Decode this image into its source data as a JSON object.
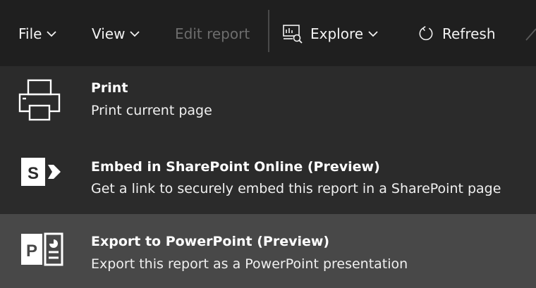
{
  "toolbar": {
    "file_label": "File",
    "view_label": "View",
    "edit_report_label": "Edit report",
    "explore_label": "Explore",
    "refresh_label": "Refresh"
  },
  "menu": {
    "items": [
      {
        "title": "Print",
        "description": "Print current page",
        "icon": "printer-icon"
      },
      {
        "title": "Embed in SharePoint Online (Preview)",
        "description": "Get a link to securely embed this report in a SharePoint page",
        "icon": "sharepoint-icon"
      },
      {
        "title": "Export to PowerPoint (Preview)",
        "description": "Export this report as a PowerPoint presentation",
        "icon": "powerpoint-icon"
      }
    ]
  },
  "colors": {
    "toolbar_bg": "#1f1f1f",
    "menu_bg": "#2b2b2b",
    "menu_highlight": "#484848",
    "text": "#ffffff",
    "disabled_text": "#6d6d6d"
  }
}
